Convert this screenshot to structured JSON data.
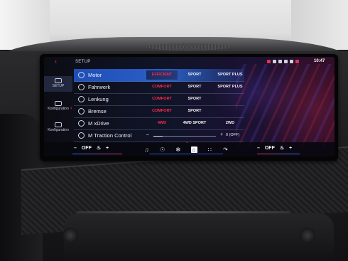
{
  "screen": {
    "breadcrumb": "SETUP",
    "clock": "10:47",
    "back_icon": "back-arrow-icon",
    "accent_color": "#e0325a",
    "highlight_color": "#2b5fc6"
  },
  "rail": {
    "items": [
      {
        "label": "SETUP",
        "icon": "setup-icon"
      },
      {
        "label": "Konfiguration",
        "icon": "m1-icon"
      },
      {
        "label": "Konfiguration",
        "icon": "m2-icon"
      }
    ]
  },
  "settings": {
    "rows": [
      {
        "label": "Motor",
        "icon": "engine-icon",
        "options": [
          "EFFICIENT",
          "SPORT",
          "SPORT PLUS"
        ],
        "active": 0,
        "selected": true
      },
      {
        "label": "Fahrwerk",
        "icon": "suspension-icon",
        "options": [
          "COMFORT",
          "SPORT",
          "SPORT PLUS"
        ],
        "active": 0
      },
      {
        "label": "Lenkung",
        "icon": "steering-icon",
        "options": [
          "COMFORT",
          "SPORT"
        ],
        "active": 0
      },
      {
        "label": "Bremse",
        "icon": "brake-icon",
        "options": [
          "COMFORT",
          "SPORT"
        ],
        "active": 0
      },
      {
        "label": "M xDrive",
        "icon": "xdrive-icon",
        "options": [
          "4WD",
          "4WD SPORT",
          "2WD"
        ],
        "active": 0
      },
      {
        "label": "M Traction Control",
        "icon": "traction-icon",
        "slider_min": "–",
        "slider_max": "+",
        "value_text": "0 (OFF)",
        "level": 0.15
      }
    ]
  },
  "bottom": {
    "left_climate": {
      "minus": "–",
      "value": "OFF",
      "plus": "+"
    },
    "right_climate": {
      "minus": "–",
      "value": "OFF",
      "plus": "+"
    },
    "nav_icons": [
      "music-icon",
      "phone-icon",
      "fan-icon",
      "home-icon",
      "apps-icon",
      "call-icon"
    ]
  }
}
